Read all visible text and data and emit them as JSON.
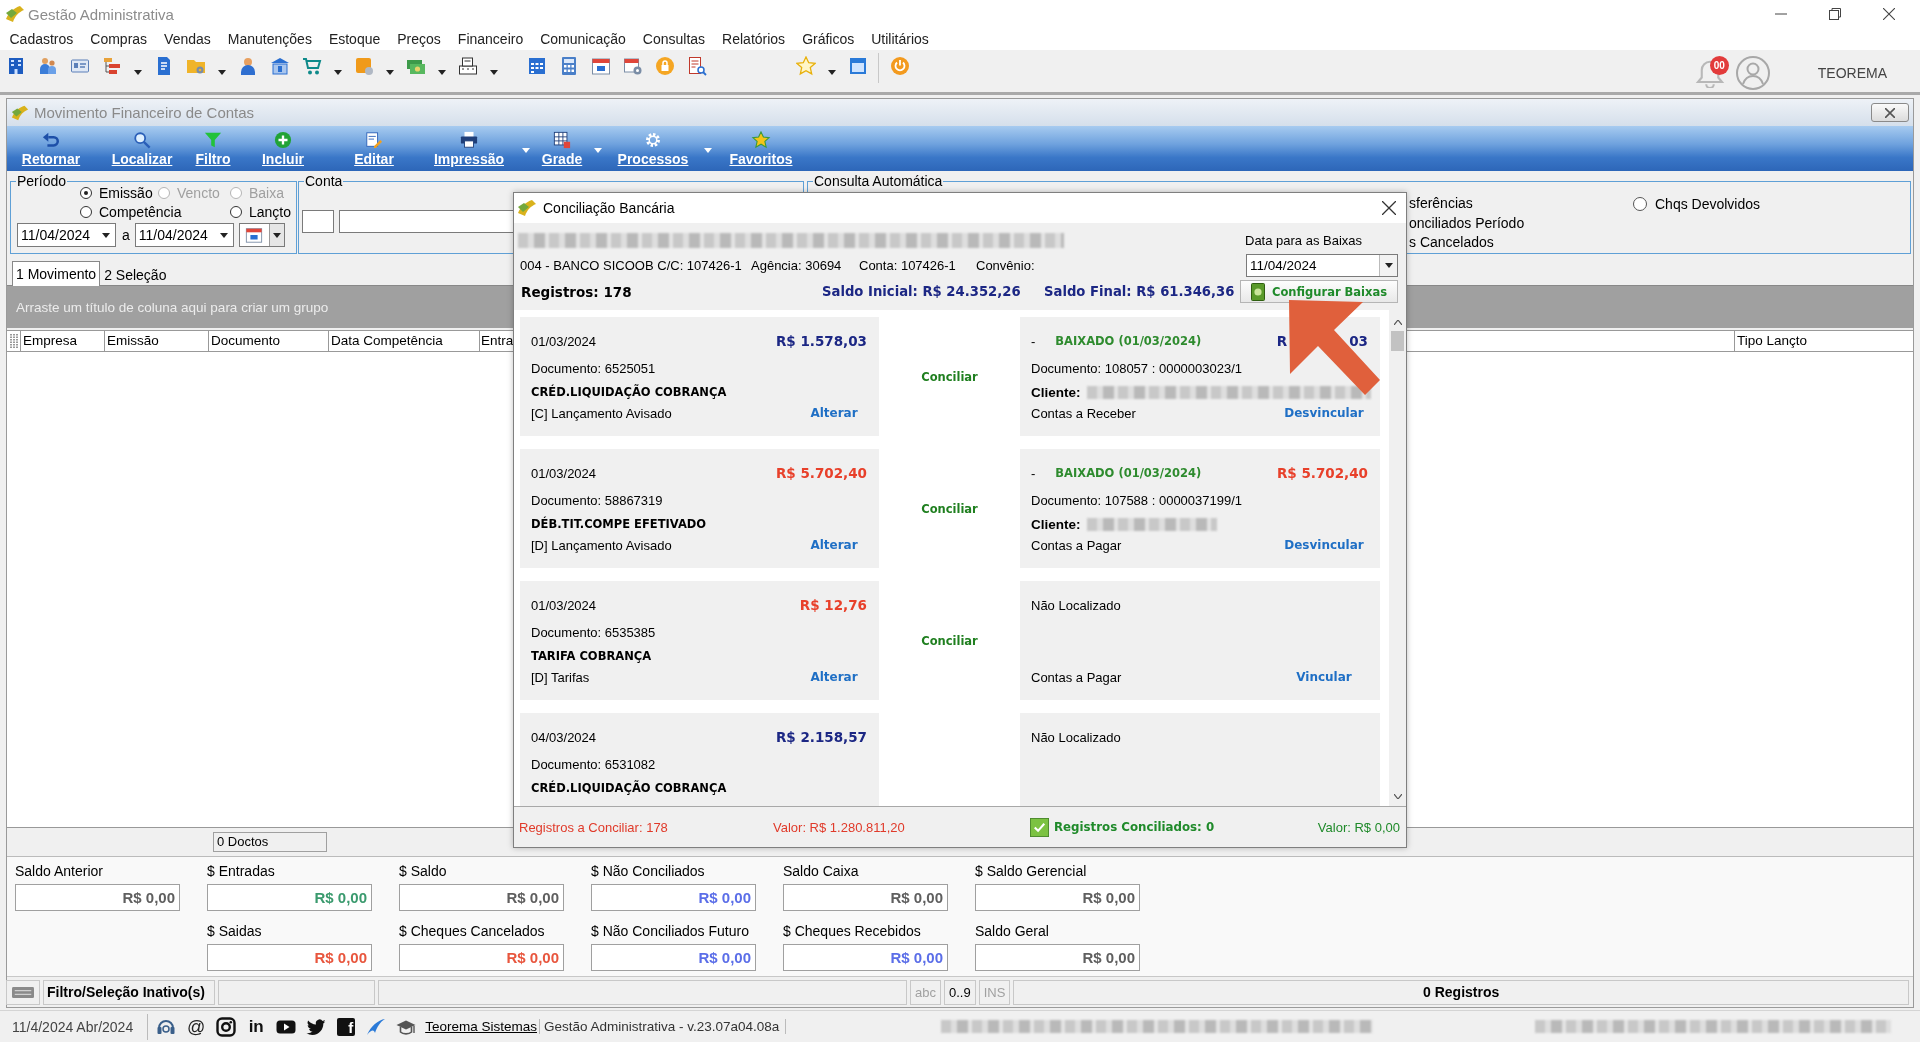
{
  "window": {
    "title": "Gestão Administrativa"
  },
  "menu": [
    "Cadastros",
    "Compras",
    "Vendas",
    "Manutenções",
    "Estoque",
    "Preços",
    "Financeiro",
    "Comunicação",
    "Consultas",
    "Relatórios",
    "Gráficos",
    "Utilitários"
  ],
  "toolbar": {
    "notification_badge": "00",
    "user": "TEOREMA"
  },
  "child_window": {
    "title": "Movimento Financeiro de Contas",
    "buttons": [
      {
        "label": "Retornar",
        "dropdown": false
      },
      {
        "label": "Localizar",
        "dropdown": false
      },
      {
        "label": "Filtro",
        "dropdown": false
      },
      {
        "label": "Incluir",
        "dropdown": false
      },
      {
        "label": "Editar",
        "dropdown": false
      },
      {
        "label": "Impressão",
        "dropdown": true
      },
      {
        "label": "Grade",
        "dropdown": true
      },
      {
        "label": "Processos",
        "dropdown": true
      },
      {
        "label": "Favoritos",
        "dropdown": false
      }
    ],
    "period": {
      "legend": "Período",
      "options": [
        {
          "label": "Emissão",
          "selected": true,
          "disabled": false
        },
        {
          "label": "Vencto",
          "selected": false,
          "disabled": true
        },
        {
          "label": "Baixa",
          "selected": false,
          "disabled": true
        },
        {
          "label": "Competência",
          "selected": false,
          "disabled": false
        },
        {
          "label": "Lançto",
          "selected": false,
          "disabled": false
        }
      ],
      "from": "11/04/2024",
      "separator": "a",
      "to": "11/04/2024"
    },
    "account": {
      "legend": "Conta"
    },
    "auto_query": {
      "legend": "Consulta Automática",
      "partial_options": [
        "sferências",
        "onciliados Período",
        "s Cancelados"
      ],
      "options": [
        {
          "label": "Chqs Devolvidos",
          "selected": false
        }
      ]
    },
    "tabs": [
      {
        "label": "1 Movimento",
        "selected": true
      },
      {
        "label": "2 Seleção",
        "selected": false
      }
    ],
    "group_hint": "Arraste um título de coluna aqui para criar um grupo",
    "columns": [
      "Empresa",
      "Emissão",
      "Documento",
      "Data Competência",
      "Entra",
      "Tipo Lançto"
    ],
    "footer": {
      "count": "0 Doctos"
    },
    "totals": {
      "row_1": [
        {
          "label": "Saldo Anterior",
          "value": "R$ 0,00",
          "color": "#5f5f5f"
        },
        {
          "label": "$ Entradas",
          "value": "R$ 0,00",
          "color": "#3a9a6e"
        },
        {
          "label": "$ Saldo",
          "value": "R$ 0,00",
          "color": "#5f5f5f"
        },
        {
          "label": "$ Não Conciliados",
          "value": "R$ 0,00",
          "color": "#5b6ee8"
        },
        {
          "label": "Saldo Caixa",
          "value": "R$ 0,00",
          "color": "#5f5f5f"
        },
        {
          "label": "$ Saldo Gerencial",
          "value": "R$ 0,00",
          "color": "#5f5f5f"
        }
      ],
      "row_2": [
        {
          "label": "$ Saidas",
          "value": "R$ 0,00",
          "color": "#e8563e"
        },
        {
          "label": "$ Cheques Cancelados",
          "value": "R$ 0,00",
          "color": "#e8563e"
        },
        {
          "label": "$ Não Conciliados Futuro",
          "value": "R$ 0,00",
          "color": "#5b6ee8"
        },
        {
          "label": "$ Cheques Recebidos",
          "value": "R$ 0,00",
          "color": "#5b6ee8"
        },
        {
          "label": "Saldo Geral",
          "value": "R$ 0,00",
          "color": "#5f5f5f"
        }
      ]
    },
    "status_bar": {
      "filter": "Filtro/Seleção Inativo(s)",
      "indicators": [
        {
          "label": "abc",
          "on": false
        },
        {
          "label": "0..9",
          "on": true
        },
        {
          "label": "INS",
          "on": false
        }
      ],
      "records": "0 Registros"
    }
  },
  "dialog": {
    "title": "Conciliação Bancária",
    "date_label": "Data para as Baixas",
    "bank": "004 - BANCO SICOOB C/C: 107426-1",
    "agency": "Agência: 30694",
    "account": "Conta: 107426-1",
    "agreement": "Convênio:",
    "date": "11/04/2024",
    "records": "Registros: 178",
    "opening_balance": "Saldo Inicial: R$ 24.352,26",
    "closing_balance": "Saldo Final: R$ 61.346,36",
    "configure_button": "Configurar Baixas",
    "entries": [
      {
        "statement": {
          "date": "01/03/2024",
          "amount": "R$ 1.578,03",
          "color": "#1c2784",
          "document": "Documento: 6525051",
          "description": "CRÉD.LIQUIDAÇÃO COBRANÇA",
          "category": "[C] Lançamento Avisado",
          "action": "Alterar"
        },
        "action": "Conciliar",
        "match": {
          "kind": "found",
          "dash": "-",
          "status": "BAIXADO (01/03/2024)",
          "amount_parts": [
            "R",
            "03"
          ],
          "color": "#1c2784",
          "document": "Documento: 108057 : 0000003023/1",
          "client_label": "Cliente:",
          "account": "Contas a Receber",
          "action": "Desvincular"
        }
      },
      {
        "statement": {
          "date": "01/03/2024",
          "amount": "R$ 5.702,40",
          "color": "#e8402a",
          "document": "Documento: 58867319",
          "description": "DÉB.TIT.COMPE EFETIVADO",
          "category": "[D] Lançamento Avisado",
          "action": "Alterar"
        },
        "action": "Conciliar",
        "match": {
          "kind": "found",
          "dash": "-",
          "status": "BAIXADO (01/03/2024)",
          "amount": "R$ 5.702,40",
          "color": "#e8402a",
          "document": "Documento: 107588 : 0000037199/1",
          "client_label": "Cliente:",
          "account": "Contas a Pagar",
          "action": "Desvincular"
        }
      },
      {
        "statement": {
          "date": "01/03/2024",
          "amount": "R$ 12,76",
          "color": "#e8402a",
          "document": "Documento: 6535385",
          "description": "TARIFA COBRANÇA",
          "category": "[D] Tarifas",
          "action": "Alterar"
        },
        "action": "Conciliar",
        "match": {
          "kind": "not_found",
          "status": "Não Localizado",
          "account": "Contas a Pagar",
          "action": "Vincular"
        }
      },
      {
        "statement": {
          "date": "04/03/2024",
          "amount": "R$ 2.158,57",
          "color": "#1c2784",
          "document": "Documento: 6531082",
          "description": "CRÉD.LIQUIDAÇÃO COBRANÇA"
        },
        "match": {
          "kind": "not_found",
          "status": "Não Localizado"
        }
      }
    ],
    "footer": {
      "to_reconcile": "Registros a Conciliar: 178",
      "to_reconcile_value": "Valor: R$ 1.280.811,20",
      "reconciled": "Registros Conciliados: 0",
      "reconciled_value": "Valor: R$ 0,00"
    }
  },
  "taskbar": {
    "date": "11/4/2024 Abr/2024",
    "at_sign": "@",
    "in_logo": "in",
    "f_logo": "f",
    "link": "Teorema Sistemas",
    "version": "Gestão Administrativa - v.23.07a04.08a"
  }
}
